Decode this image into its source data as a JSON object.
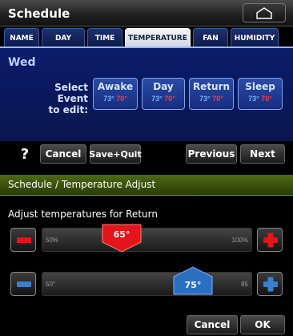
{
  "schedule": {
    "title": "Schedule",
    "home_icon": "home-outline-icon",
    "tabs": [
      {
        "label": "NAME",
        "active": false
      },
      {
        "label": "DAY",
        "active": false
      },
      {
        "label": "TIME",
        "active": false
      },
      {
        "label": "TEMPERATURE",
        "active": true
      },
      {
        "label": "FAN",
        "active": false
      },
      {
        "label": "HUMIDITY",
        "active": false
      }
    ],
    "day": "Wed",
    "select_label_line1": "Select Event",
    "select_label_line2": "to edit:",
    "events": [
      {
        "name": "Awake",
        "cool": "73°",
        "heat": "70°"
      },
      {
        "name": "Day",
        "cool": "73°",
        "heat": "70°"
      },
      {
        "name": "Return",
        "cool": "73°",
        "heat": "70°"
      },
      {
        "name": "Sleep",
        "cool": "73°",
        "heat": "70°"
      }
    ],
    "bottom_buttons": {
      "help": "?",
      "cancel": "Cancel",
      "save_quit": "Save+Quit",
      "previous": "Previous",
      "next": "Next"
    }
  },
  "adjust": {
    "title": "Schedule / Temperature Adjust",
    "subtitle": "Adjust temperatures for Return",
    "heat": {
      "value": "65°",
      "min": "50%",
      "max": "100%",
      "color": "#e4141b",
      "position_fraction": 0.38
    },
    "cool": {
      "value": "75°",
      "min": "50°",
      "max": "85",
      "color": "#2a6fc0",
      "position_fraction": 0.72
    },
    "buttons": {
      "cancel": "Cancel",
      "ok": "OK"
    }
  },
  "colors": {
    "heat": "#e4141b",
    "cool": "#3a7fd0",
    "schedule_panel": "#0b1c6b",
    "adjust_titlebar": "#4d6a12"
  }
}
